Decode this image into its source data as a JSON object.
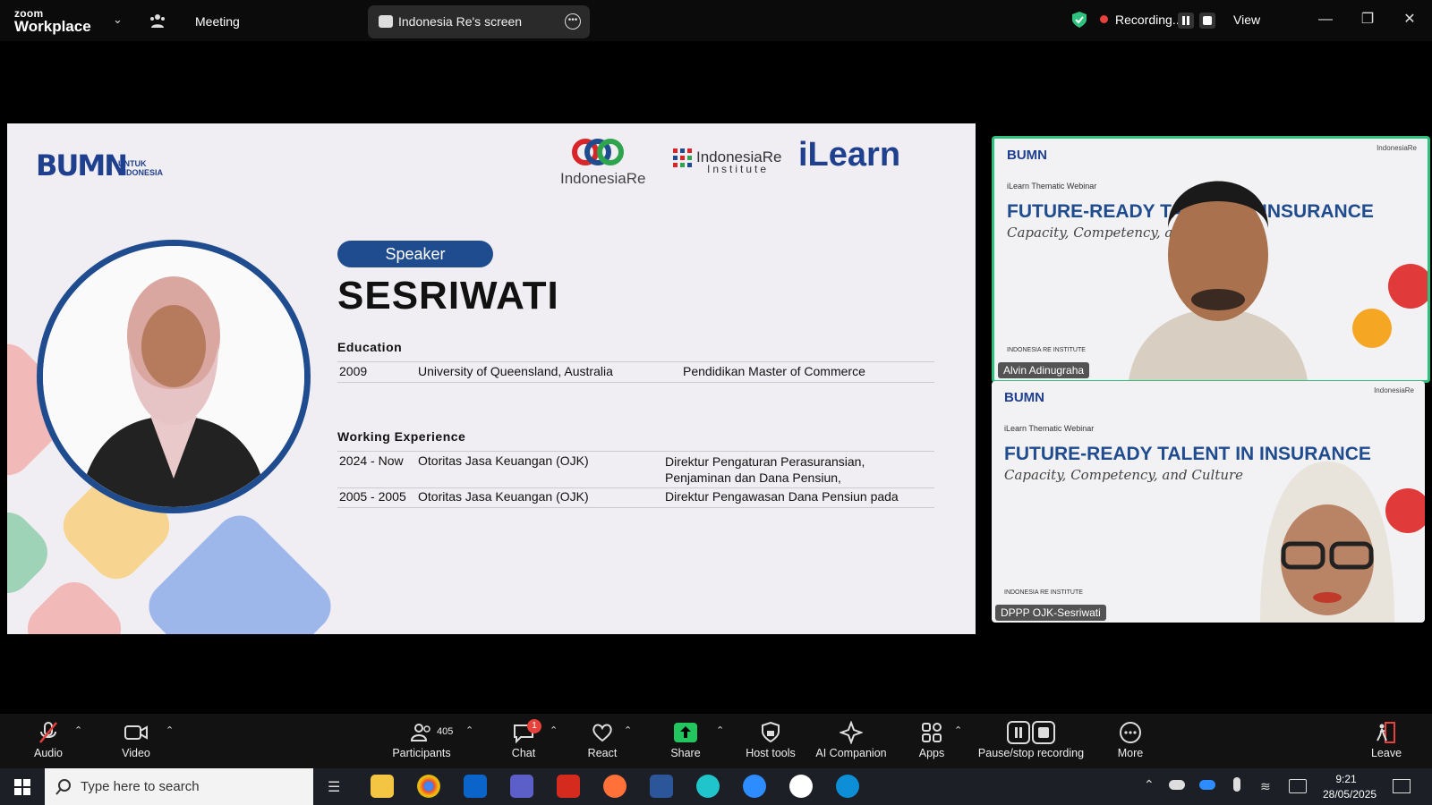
{
  "titlebar": {
    "brand_small": "zoom",
    "brand_big": "Workplace",
    "meeting_label": "Meeting",
    "screen_label": "Indonesia Re's screen",
    "recording_label": "Recording...",
    "view_label": "View"
  },
  "slide": {
    "bumn_text": "BUMN",
    "bumn_sub": "UNTUK INDONESIA",
    "logo_ire": "IndonesiaRe",
    "logo_iri": "IndonesiaRe",
    "logo_iri_sub": "Institute",
    "logo_ilearn": "iLearn",
    "speaker_badge": "Speaker",
    "speaker_name": "SESRIWATI",
    "education_title": "Education",
    "education": [
      {
        "year": "2009",
        "institution": "University of Queensland, Australia",
        "degree": "Pendidikan Master of Commerce"
      }
    ],
    "work_title": "Working Experience",
    "work": [
      {
        "period": "2024 - Now",
        "org": "Otoritas Jasa Keuangan (OJK)",
        "role": "Direktur Pengaturan Perasuransian, Penjaminan dan Dana Pensiun,"
      },
      {
        "period": "2005 - 2005",
        "org": "Otoritas Jasa Keuangan (OJK)",
        "role": "Direktur Pengawasan Dana Pensiun pada"
      }
    ]
  },
  "gallery": [
    {
      "webinar": "iLearn Thematic Webinar",
      "title": "FUTURE-READY TALENT IN INSURANCE",
      "subtitle": "Capacity, Competency, and Culture",
      "name": "Alvin Adinugraha",
      "org": "INDONESIA RE INSTITUTE"
    },
    {
      "webinar": "iLearn Thematic Webinar",
      "title": "FUTURE-READY TALENT IN INSURANCE",
      "subtitle": "Capacity, Competency, and Culture",
      "name": "DPPP OJK-Sesriwati",
      "org": "INDONESIA RE INSTITUTE"
    }
  ],
  "toolbar": {
    "audio": "Audio",
    "video": "Video",
    "participants": "Participants",
    "participants_count": "405",
    "chat": "Chat",
    "chat_badge": "1",
    "react": "React",
    "share": "Share",
    "host_tools": "Host tools",
    "ai_companion": "AI Companion",
    "apps": "Apps",
    "pause_recording": "Pause/stop recording",
    "more": "More",
    "leave": "Leave"
  },
  "taskbar": {
    "search_placeholder": "Type here to search",
    "time": "9:21",
    "date": "28/05/2025"
  },
  "colors": {
    "accent_blue": "#1f4c8e",
    "active_speaker": "#2ec27e",
    "recording": "#e8413b",
    "share_green": "#22c55e"
  }
}
